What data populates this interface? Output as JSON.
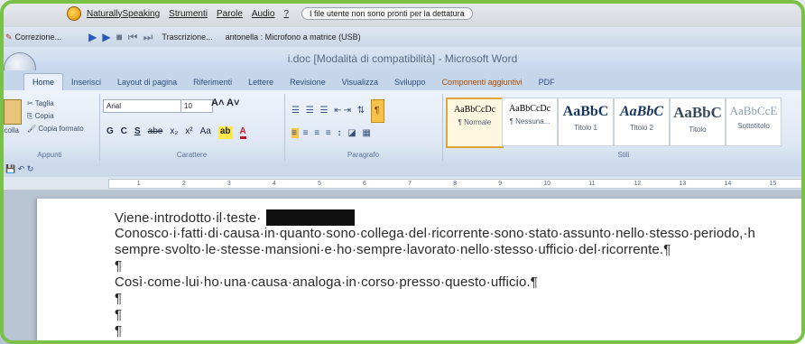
{
  "dragon": {
    "menu": [
      "NaturallySpeaking",
      "Strumenti",
      "Parole",
      "Audio",
      "?"
    ],
    "message": "I file utente non sono pronti per la dettatura"
  },
  "recorder": {
    "correction_label": "Correzione...",
    "transcription_label": "Trascrizione...",
    "mic_label": "antonella : Microfono a matrice (USB)"
  },
  "word": {
    "title": "i.doc [Modalità di compatibilità] - Microsoft Word",
    "tabs": [
      "Home",
      "Inserisci",
      "Layout di pagina",
      "Riferimenti",
      "Lettere",
      "Revisione",
      "Visualizza",
      "Sviluppo",
      "Componenti aggiuntivi",
      "PDF"
    ],
    "active_tab": "Home",
    "clipboard": {
      "cut": "Taglia",
      "copy": "Copia",
      "format_painter": "Copia formato",
      "paste_short": "ncolla",
      "group": "Appunti"
    },
    "font": {
      "name": "Arial",
      "size": "10",
      "group": "Carattere",
      "format_buttons": [
        "G",
        "C",
        "S",
        "abe",
        "x₂",
        "x²",
        "Aa"
      ]
    },
    "paragraph": {
      "group": "Paragrafo"
    },
    "styles": {
      "group": "Stili",
      "tiles": [
        {
          "sample": "AaBbCcDc",
          "name": "¶ Normale",
          "selected": true
        },
        {
          "sample": "AaBbCcDc",
          "name": "¶ Nessuna..."
        },
        {
          "sample": "AaBbC",
          "name": "Titolo 1"
        },
        {
          "sample": "AaBbC",
          "name": "Titolo 2"
        },
        {
          "sample": "AaBbC",
          "name": "Titolo"
        },
        {
          "sample": "AaBbCcE",
          "name": "Sottotitolo"
        }
      ]
    },
    "ruler_numbers": [
      "1",
      "2",
      "3",
      "4",
      "5",
      "6",
      "7",
      "8",
      "9",
      "10",
      "11",
      "12",
      "13",
      "14",
      "15"
    ]
  },
  "document": {
    "lines": {
      "l1": "Viene·introdotto·il·teste·",
      "l2": "Conosco·i·fatti·di·causa·in·quanto·sono·collega·del·ricorrente·sono·stato·assunto·nello·stesso·periodo,·h",
      "l3": "sempre·svolto·le·stesse·mansioni·e·ho·sempre·lavorato·nello·stesso·ufficio·del·ricorrente.¶",
      "l4": "¶",
      "l5": "Così·come·lui·ho·una·causa·analoga·in·corso·presso·questo·ufficio.¶",
      "l6": "¶",
      "l7": "¶",
      "l8": "¶"
    }
  }
}
